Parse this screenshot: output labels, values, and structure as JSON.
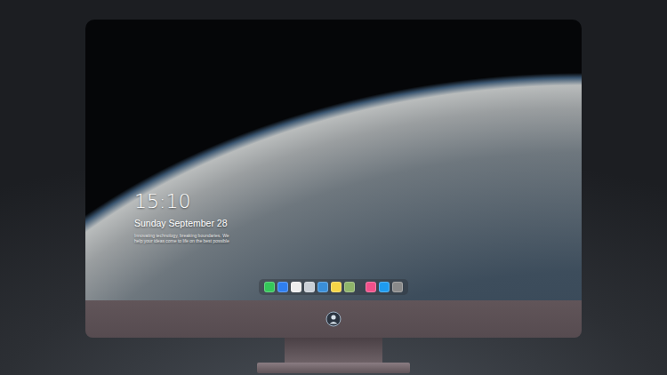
{
  "lock_screen": {
    "time": "15:10",
    "date": "Sunday September 28",
    "tagline": [
      "Innovating technology, breaking boundaries. We",
      "help your ideas come to life on the best possible"
    ]
  },
  "dock": [
    {
      "items": [
        {
          "name": "messages",
          "color": "#34c759"
        },
        {
          "name": "files",
          "color": "#2f7ff0"
        },
        {
          "name": "clock",
          "color": "#eeeeee"
        },
        {
          "name": "preview",
          "color": "#c9cfd6"
        },
        {
          "name": "video",
          "color": "#3a8fd9"
        },
        {
          "name": "notes",
          "color": "#f5d547"
        },
        {
          "name": "photos",
          "color": "#8fb46a"
        }
      ]
    },
    {
      "items": [
        {
          "name": "music",
          "color": "#f0508a"
        },
        {
          "name": "store",
          "color": "#1e9bf0"
        },
        {
          "name": "camera",
          "color": "#8a8a8a"
        }
      ]
    }
  ]
}
